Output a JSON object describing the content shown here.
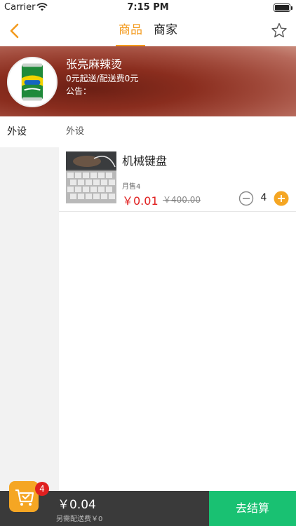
{
  "status_bar": {
    "carrier": "Carrier",
    "time": "7:15 PM"
  },
  "nav": {
    "tabs": [
      {
        "label": "商品",
        "active": true
      },
      {
        "label": "商家",
        "active": false
      }
    ],
    "back_icon": "chevron-left-icon",
    "favorite_icon": "star-icon"
  },
  "shop": {
    "name": "张亮麻辣烫",
    "delivery_info": "0元起送/配送费0元",
    "notice": "公告："
  },
  "categories": [
    {
      "label": "外设",
      "selected": true
    }
  ],
  "products_section": {
    "title": "外设",
    "items": [
      {
        "name": "机械键盘",
        "monthly_sales": "月售4",
        "price": "￥0.01",
        "original_price": "￥400.00",
        "quantity": "4"
      }
    ]
  },
  "cart": {
    "badge_count": "4",
    "total": "￥0.04",
    "delivery_note": "另需配送费￥0",
    "checkout_label": "去结算"
  },
  "colors": {
    "accent": "#f39a1d",
    "price": "#e02020",
    "checkout": "#19c172",
    "bottom_bar": "#3a3a3a"
  }
}
